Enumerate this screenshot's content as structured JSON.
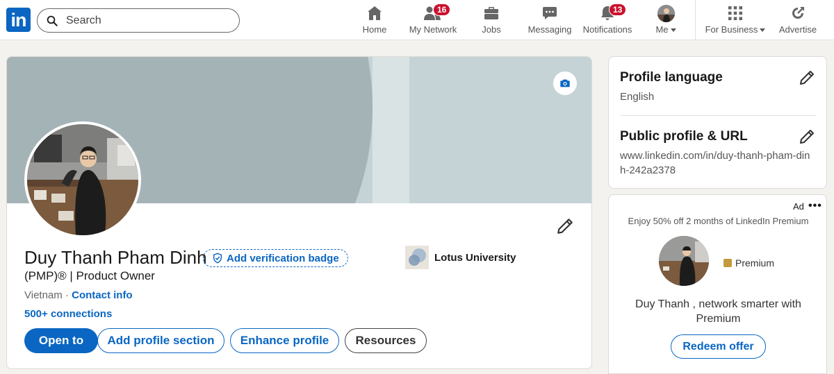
{
  "nav": {
    "logo_text": "in",
    "search_placeholder": "Search",
    "items": [
      {
        "label": "Home",
        "icon": "home-icon"
      },
      {
        "label": "My Network",
        "icon": "network-icon",
        "badge": "16"
      },
      {
        "label": "Jobs",
        "icon": "briefcase-icon"
      },
      {
        "label": "Messaging",
        "icon": "messaging-icon"
      },
      {
        "label": "Notifications",
        "icon": "bell-icon",
        "badge": "13"
      },
      {
        "label": "Me",
        "icon": "avatar"
      },
      {
        "label": "For Business",
        "icon": "grid-icon"
      },
      {
        "label": "Advertise",
        "icon": "advertise-icon"
      }
    ]
  },
  "profile": {
    "name": "Duy Thanh Pham Dinh",
    "verification_label": "Add verification badge",
    "headline": "(PMP)® | Product Owner",
    "location": "Vietnam",
    "separator": "·",
    "contact_info": "Contact info",
    "connections": "500+ connections",
    "education": "Lotus University",
    "buttons": {
      "open_to": "Open to",
      "add_section": "Add profile section",
      "enhance": "Enhance profile",
      "resources": "Resources"
    }
  },
  "sidebar": {
    "language_title": "Profile language",
    "language_value": "English",
    "url_title": "Public profile & URL",
    "url_value": "www.linkedin.com/in/duy-thanh-pham-dinh-242a2378"
  },
  "ad": {
    "tag": "Ad",
    "menu": "•••",
    "promo": "Enjoy 50% off 2 months of LinkedIn Premium",
    "premium_label": "Premium",
    "message": "Duy Thanh , network smarter with Premium",
    "cta": "Redeem offer"
  },
  "colors": {
    "brand": "#0a66c2",
    "badge": "#cb112d",
    "banner_dark": "#a4b3b6",
    "banner_light": "#c5d3d6",
    "page_bg": "#f4f2ee"
  }
}
